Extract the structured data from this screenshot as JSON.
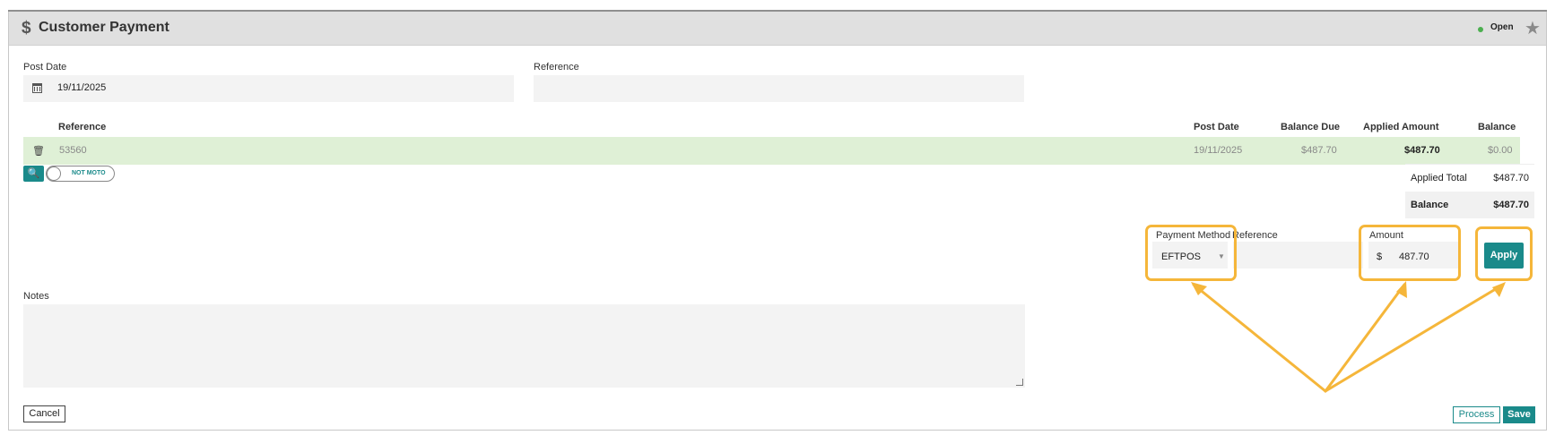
{
  "header": {
    "title": "Customer Payment",
    "status": "Open",
    "status_color": "#4caf50",
    "icons": [
      "dollar-icon",
      "star-icon"
    ]
  },
  "form": {
    "post_date_label": "Post Date",
    "post_date_value": "19/11/2025",
    "reference_label": "Reference",
    "reference_value": ""
  },
  "table": {
    "columns": [
      "Reference",
      "Post Date",
      "Balance Due",
      "Applied Amount",
      "Balance"
    ],
    "rows": [
      {
        "reference": "53560",
        "post_date": "19/11/2025",
        "balance_due": "$487.70",
        "applied_amount": "$487.70",
        "balance": "$0.00"
      }
    ]
  },
  "toggle": {
    "label": "NOT MOTO"
  },
  "totals": {
    "applied_total_label": "Applied Total",
    "applied_total_value": "$487.70",
    "balance_label": "Balance",
    "balance_value": "$487.70"
  },
  "payment": {
    "method_label": "Payment Method",
    "method_value": "EFTPOS",
    "reference_label": "Reference",
    "amount_label": "Amount",
    "currency_symbol": "$",
    "amount_value": "487.70",
    "apply_label": "Apply"
  },
  "notes": {
    "label": "Notes",
    "value": ""
  },
  "footer": {
    "cancel_label": "Cancel",
    "process_label": "Process",
    "save_label": "Save"
  },
  "colors": {
    "accent": "#1a8a8a",
    "row_highlight": "#dff0d6",
    "annotation": "#f5b63a"
  }
}
